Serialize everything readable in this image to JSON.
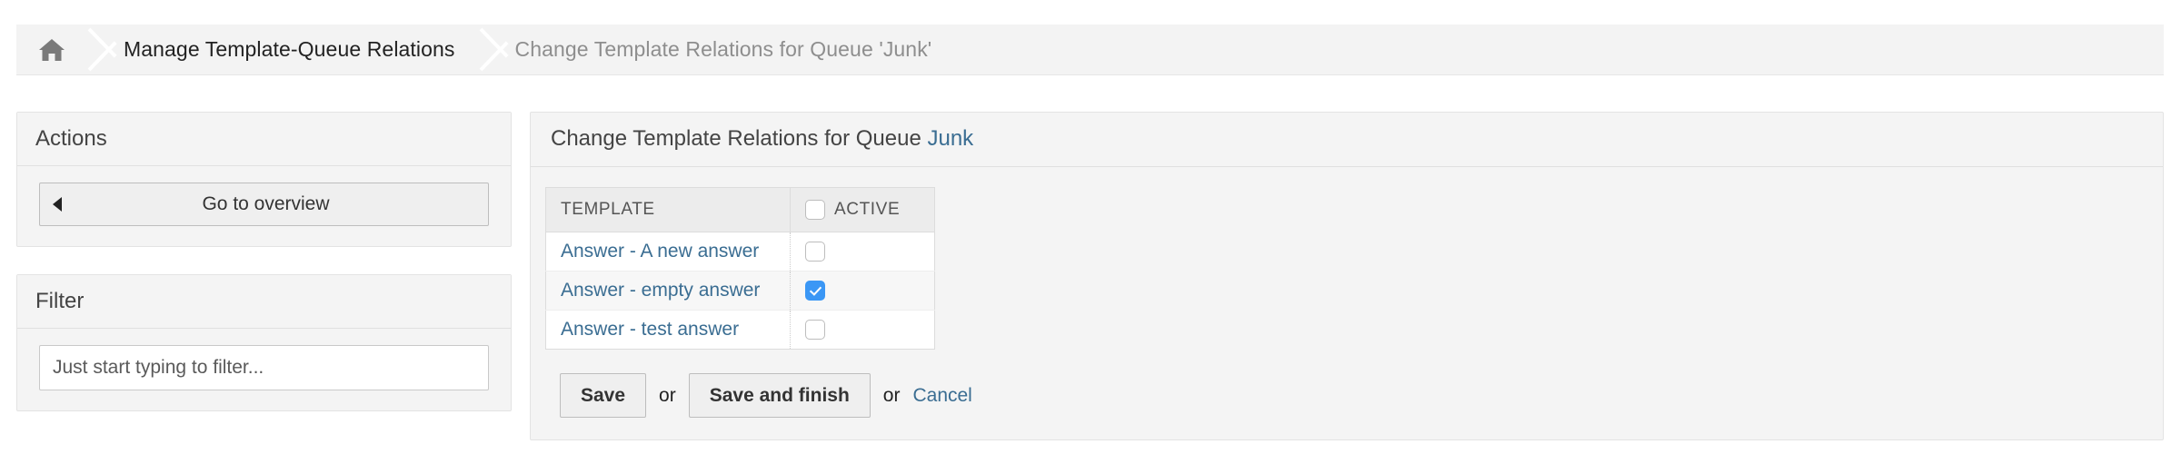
{
  "breadcrumb": {
    "home_icon": "home-icon",
    "items": [
      {
        "label": "Manage Template-Queue Relations",
        "current": false
      },
      {
        "label": "Change Template Relations for Queue 'Junk'",
        "current": true
      }
    ]
  },
  "sidebar": {
    "actions": {
      "title": "Actions",
      "go_to_overview_label": "Go to overview",
      "back_icon": "caret-left-icon"
    },
    "filter": {
      "title": "Filter",
      "input_value": "",
      "input_placeholder": "Just start typing to filter..."
    }
  },
  "main": {
    "header_prefix": "Change Template Relations for Queue",
    "header_queue": "Junk",
    "table": {
      "columns": [
        "TEMPLATE",
        "ACTIVE"
      ],
      "header_checkbox_checked": false,
      "rows": [
        {
          "template": "Answer - A new answer",
          "active": false
        },
        {
          "template": "Answer - empty answer",
          "active": true
        },
        {
          "template": "Answer - test answer",
          "active": false
        }
      ]
    },
    "footer": {
      "save_label": "Save",
      "or_label_1": "or",
      "save_and_finish_label": "Save and finish",
      "or_label_2": "or",
      "cancel_label": "Cancel"
    }
  },
  "colors": {
    "link": "#3a6d92",
    "checkbox_checked": "#3b97f5",
    "panel_bg": "#f4f4f4",
    "breadcrumb_bg": "#f3f3f3",
    "breadcrumb_current_text": "#8e8e8e"
  }
}
